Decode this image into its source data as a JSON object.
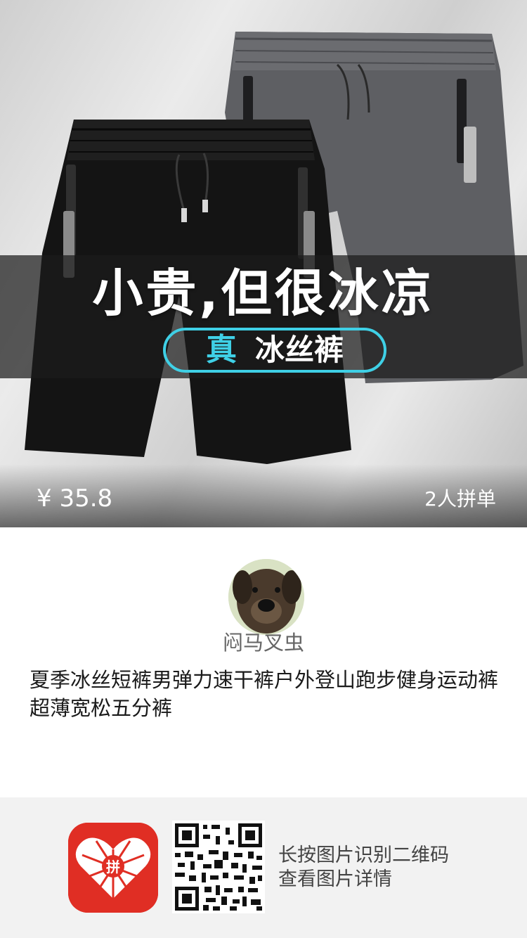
{
  "product": {
    "headline": "小贵,但很冰凉",
    "badge_true": "真",
    "badge_text": "冰丝裤",
    "price": "¥ 35.8",
    "group_count": "2人拼单",
    "title": "夏季冰丝短裤男弹力速干裤户外登山跑步健身运动裤超薄宽松五分裤"
  },
  "seller": {
    "name": "闷马叉虫"
  },
  "footer": {
    "app_logo_text": "拼",
    "hint_line1": "长按图片识别二维码",
    "hint_line2": "查看图片详情"
  },
  "colors": {
    "accent_cyan": "#3fd0e6",
    "brand_red": "#e02e24"
  }
}
